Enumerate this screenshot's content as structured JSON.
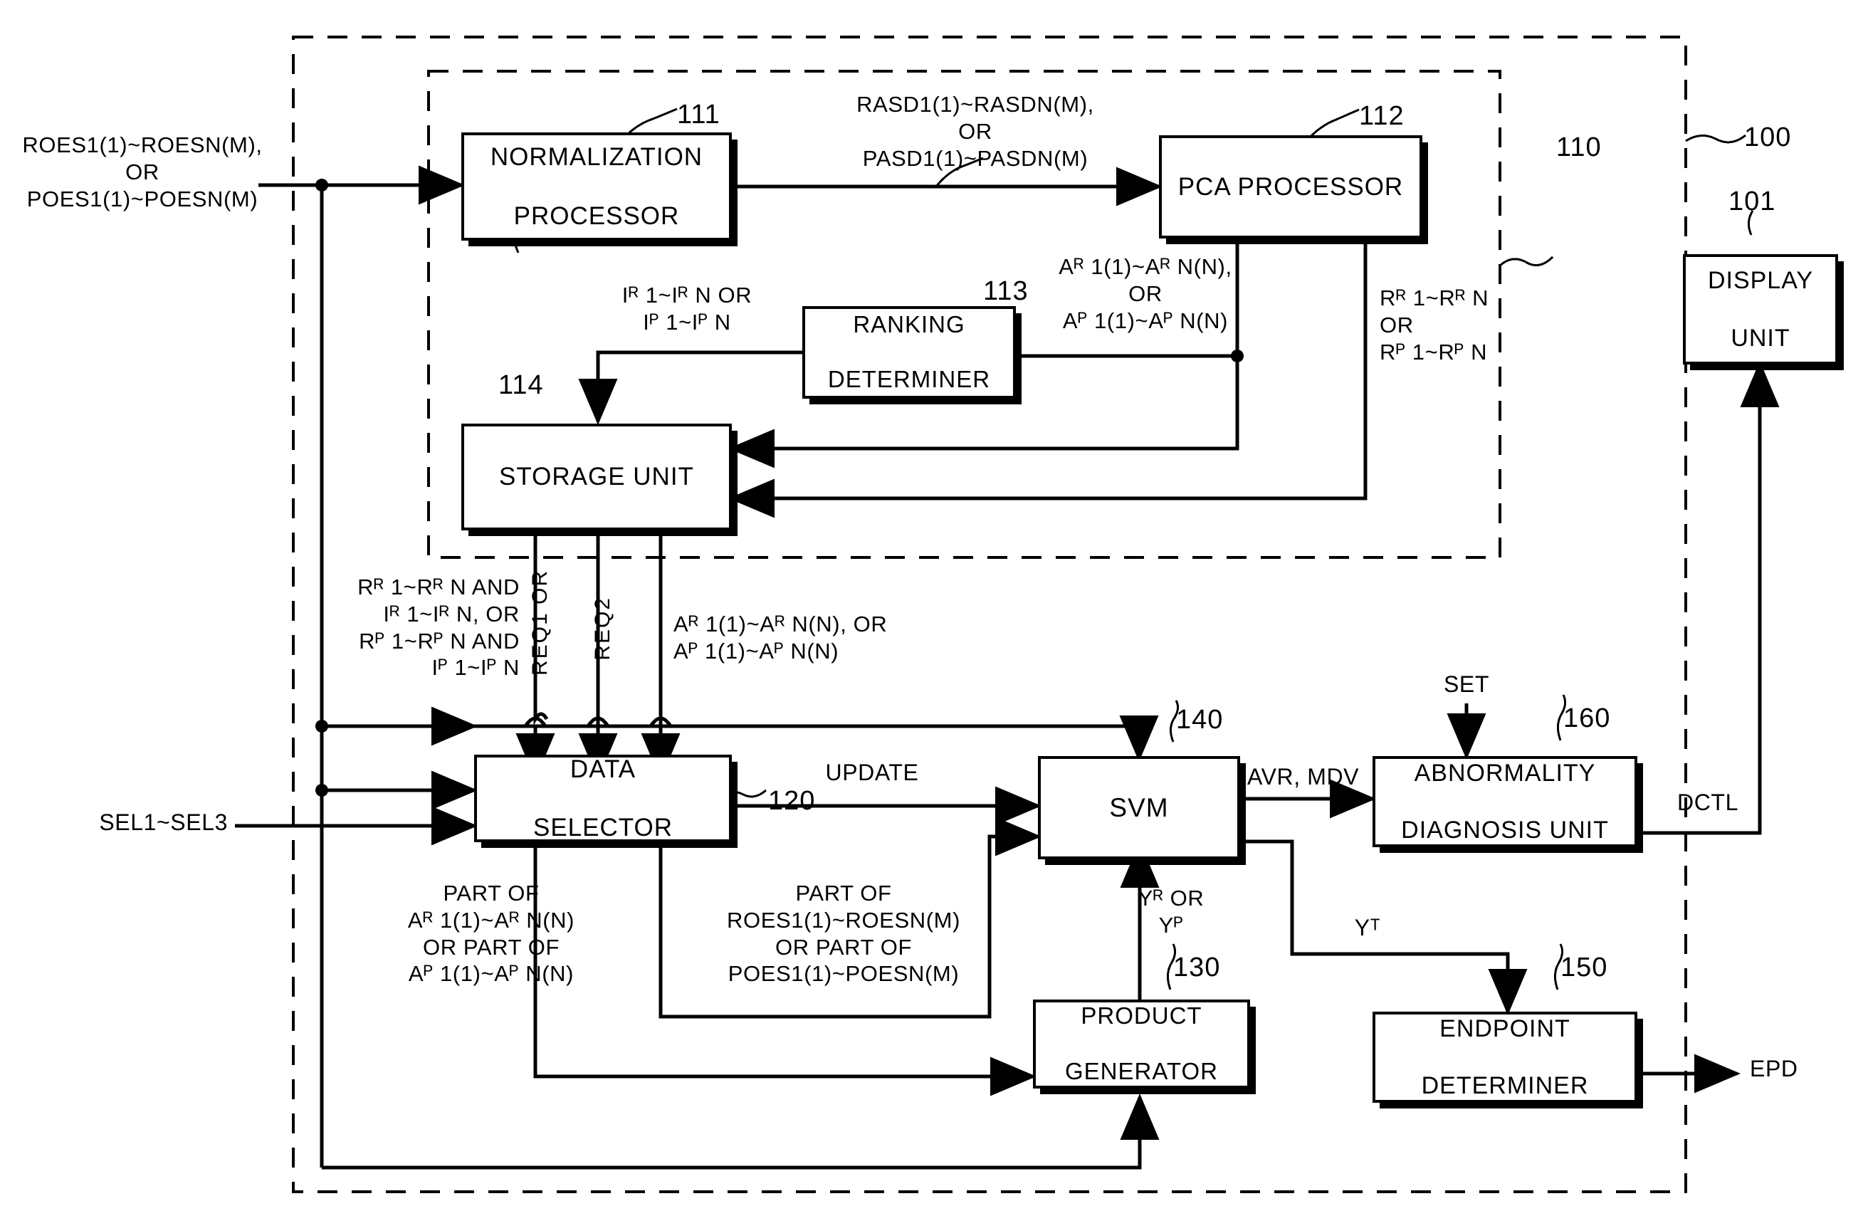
{
  "figure": {
    "type": "patent-block-diagram",
    "outer_ref": "100",
    "inner_ref": "110"
  },
  "blocks": [
    {
      "id": "normalization-processor",
      "ref": "111",
      "lines": [
        "NORMALIZATION",
        "PROCESSOR"
      ]
    },
    {
      "id": "pca-processor",
      "ref": "112",
      "lines": [
        "PCA PROCESSOR"
      ]
    },
    {
      "id": "ranking-determiner",
      "ref": "113",
      "lines": [
        "RANKING",
        "DETERMINER"
      ]
    },
    {
      "id": "storage-unit",
      "ref": "114",
      "lines": [
        "STORAGE UNIT"
      ]
    },
    {
      "id": "data-selector",
      "ref": "120",
      "lines": [
        "DATA",
        "SELECTOR"
      ]
    },
    {
      "id": "product-generator",
      "ref": "130",
      "lines": [
        "PRODUCT",
        "GENERATOR"
      ]
    },
    {
      "id": "svm",
      "ref": "140",
      "lines": [
        "SVM"
      ]
    },
    {
      "id": "endpoint-determiner",
      "ref": "150",
      "lines": [
        "ENDPOINT",
        "DETERMINER"
      ]
    },
    {
      "id": "abnormality-diagnosis-unit",
      "ref": "160",
      "lines": [
        "ABNORMALITY",
        "DIAGNOSIS UNIT"
      ]
    },
    {
      "id": "display-unit",
      "ref": "101",
      "lines": [
        "DISPLAY",
        "UNIT"
      ]
    }
  ],
  "signals": {
    "input_raw": "ROES1(1)~ROESN(M),\nOR\nPOES1(1)~POESN(M)",
    "normalized_out": "RASD1(1)~RASDN(M),\nOR\nPASD1(1)~PASDN(M)",
    "ranking_in": "Iᴿ 1~Iᴿ N OR\nIᴾ 1~Iᴾ N",
    "ranking_out": "Aᴿ 1(1)~Aᴿ N(N),\nOR\nAᴾ 1(1)~Aᴾ N(N)",
    "pca_ranks": "Rᴿ 1~Rᴿ N\nOR\nRᴾ 1~Rᴾ N",
    "storage_ranks_idx": "Rᴿ 1~Rᴿ N AND\nIᴿ 1~Iᴿ N, OR\nRᴾ 1~Rᴾ N AND\nIᴾ 1~Iᴾ N",
    "storage_amp": "Aᴿ 1(1)~Aᴿ N(N), OR\nAᴾ 1(1)~Aᴾ N(N)",
    "req": "REQ1 OR",
    "req2": "REQ2",
    "select_ctrl": "SEL1~SEL3",
    "update": "UPDATE",
    "part_of_amp": "PART OF\nAᴿ 1(1)~Aᴿ N(N)\nOR PART OF\nAᴾ 1(1)~Aᴾ N(N)",
    "part_of_raw": "PART OF\nROES1(1)~ROESN(M)\nOR PART OF\nPOES1(1)~POESN(M)",
    "svm_product_in": "Yᴿ OR\nYᴾ",
    "svm_out": "AVR, MDV",
    "svm_yt": "Yᵀ",
    "set": "SET",
    "dctl": "DCTL",
    "epd": "EPD"
  },
  "refs": {
    "outer": "100",
    "display": "101",
    "extractor": "110",
    "normalization": "111",
    "pca": "112",
    "ranking": "113",
    "storage": "114",
    "selector": "120",
    "product": "130",
    "svm": "140",
    "endpoint": "150",
    "abnormality": "160"
  },
  "colors": {
    "line": "#000000",
    "background": "#ffffff"
  }
}
